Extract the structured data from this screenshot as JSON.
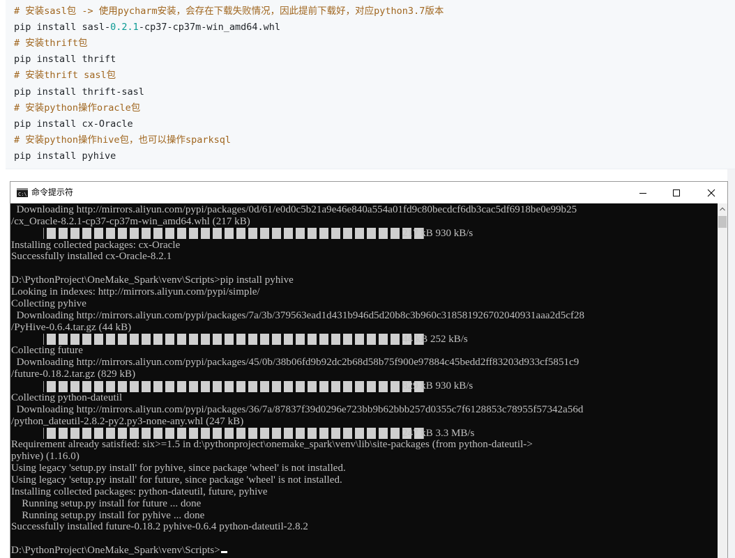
{
  "code_block": {
    "lines": [
      {
        "type": "comment",
        "text": "# 安装sasl包 -> 使用pycharm安装，会存在下载失败情况，因此提前下载好，对应python3.7版本"
      },
      {
        "type": "code",
        "text": "pip install sasl-",
        "version": "0.2.1",
        "rest": "-cp37-cp37m-win_amd64.whl"
      },
      {
        "type": "comment",
        "text": "# 安装thrift包"
      },
      {
        "type": "code",
        "text": "pip install thrift"
      },
      {
        "type": "comment",
        "text": "# 安装thrift sasl包"
      },
      {
        "type": "code",
        "text": "pip install thrift-sasl"
      },
      {
        "type": "comment",
        "text": "# 安装python操作oracle包"
      },
      {
        "type": "code",
        "text": "pip install cx-Oracle"
      },
      {
        "type": "comment",
        "text": "# 安装python操作hive包，也可以操作sparksql"
      },
      {
        "type": "code",
        "text": "pip install pyhive"
      }
    ],
    "comment_color": "#a0661f",
    "version_color": "#0b9a93"
  },
  "window": {
    "title": "命令提示符",
    "icon": "cmd-icon",
    "controls": [
      "minimize-icon",
      "maximize-icon",
      "close-icon"
    ]
  },
  "console": {
    "lines": [
      {
        "kind": "text",
        "text": "  Downloading http://mirrors.aliyun.com/pypi/packages/0d/61/e0d0c5b21a9e46e840a554a01fd9c80becdcf6db3cac5df6918be0e99b25"
      },
      {
        "kind": "text",
        "text": "/cx_Oracle-8.2.1-cp37-cp37m-win_amd64.whl (217 kB)"
      },
      {
        "kind": "progress",
        "text": "217 kB 930 kB/s",
        "fraction": 1.0
      },
      {
        "kind": "text",
        "text": "Installing collected packages: cx-Oracle"
      },
      {
        "kind": "text",
        "text": "Successfully installed cx-Oracle-8.2.1"
      },
      {
        "kind": "text",
        "text": ""
      },
      {
        "kind": "text",
        "text": "D:\\PythonProject\\OneMake_Spark\\venv\\Scripts>pip install pyhive"
      },
      {
        "kind": "text",
        "text": "Looking in indexes: http://mirrors.aliyun.com/pypi/simple/"
      },
      {
        "kind": "text",
        "text": "Collecting pyhive"
      },
      {
        "kind": "text",
        "text": "  Downloading http://mirrors.aliyun.com/pypi/packages/7a/3b/379563ead1d431b946d5d20b8c3b960c318581926702040931aaa2d5cf28"
      },
      {
        "kind": "text",
        "text": "/PyHive-0.6.4.tar.gz (44 kB)"
      },
      {
        "kind": "progress",
        "text": "44 kB 252 kB/s",
        "fraction": 1.0
      },
      {
        "kind": "text",
        "text": "Collecting future"
      },
      {
        "kind": "text",
        "text": "  Downloading http://mirrors.aliyun.com/pypi/packages/45/0b/38b06fd9b92dc2b68d58b75f900e97884c45bedd2ff83203d933cf5851c9"
      },
      {
        "kind": "text",
        "text": "/future-0.18.2.tar.gz (829 kB)"
      },
      {
        "kind": "progress",
        "text": "829 kB 930 kB/s",
        "fraction": 1.0
      },
      {
        "kind": "text",
        "text": "Collecting python-dateutil"
      },
      {
        "kind": "text",
        "text": "  Downloading http://mirrors.aliyun.com/pypi/packages/36/7a/87837f39d0296e723bb9b62bbb257d0355c7f6128853c78955f57342a56d"
      },
      {
        "kind": "text",
        "text": "/python_dateutil-2.8.2-py2.py3-none-any.whl (247 kB)"
      },
      {
        "kind": "progress",
        "text": "247 kB 3.3 MB/s",
        "fraction": 1.0
      },
      {
        "kind": "text",
        "text": "Requirement already satisfied: six>=1.5 in d:\\pythonproject\\onemake_spark\\venv\\lib\\site-packages (from python-dateutil->"
      },
      {
        "kind": "text",
        "text": "pyhive) (1.16.0)"
      },
      {
        "kind": "text",
        "text": "Using legacy 'setup.py install' for pyhive, since package 'wheel' is not installed."
      },
      {
        "kind": "text",
        "text": "Using legacy 'setup.py install' for future, since package 'wheel' is not installed."
      },
      {
        "kind": "text",
        "text": "Installing collected packages: python-dateutil, future, pyhive"
      },
      {
        "kind": "text",
        "text": "    Running setup.py install for future ... done"
      },
      {
        "kind": "text",
        "text": "    Running setup.py install for pyhive ... done"
      },
      {
        "kind": "text",
        "text": "Successfully installed future-0.18.2 pyhive-0.6.4 python-dateutil-2.8.2"
      },
      {
        "kind": "text",
        "text": ""
      },
      {
        "kind": "prompt",
        "text": "D:\\PythonProject\\OneMake_Spark\\venv\\Scripts>"
      }
    ],
    "text_color": "#c0c0c0",
    "background": "#0c0c0c"
  }
}
